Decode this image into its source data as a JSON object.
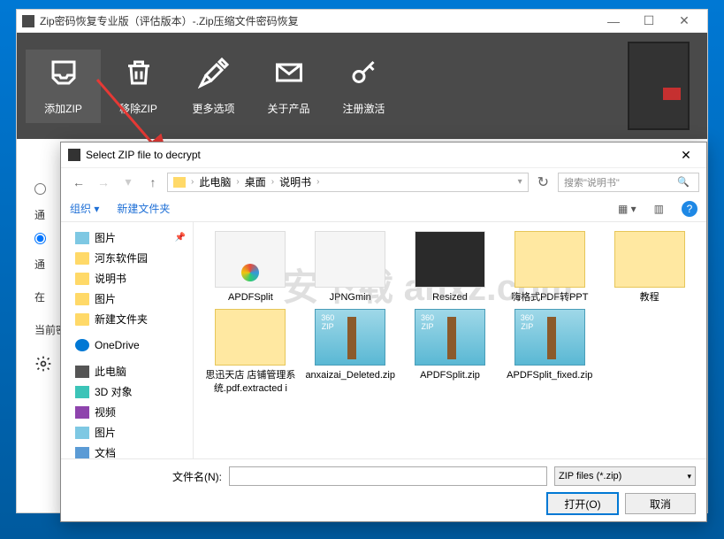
{
  "main": {
    "title": "Zip密码恢复专业版（评估版本）-.Zip压缩文件密码恢复",
    "toolbar": {
      "add_zip": "添加ZIP",
      "remove_zip": "移除ZIP",
      "more_options": "更多选项",
      "about": "关于产品",
      "register": "注册激活"
    },
    "body": {
      "radio1_label": "通",
      "radio2_label": "通",
      "side_label": "在",
      "current_label": "当前密"
    }
  },
  "dialog": {
    "title": "Select ZIP file to decrypt",
    "breadcrumb": [
      "此电脑",
      "桌面",
      "说明书"
    ],
    "search_placeholder": "搜索\"说明书\"",
    "organize": "组织",
    "new_folder": "新建文件夹",
    "tree": [
      {
        "icon": "img",
        "label": "图片",
        "pin": true
      },
      {
        "icon": "folder",
        "label": "河东软件园"
      },
      {
        "icon": "folder",
        "label": "说明书"
      },
      {
        "icon": "folder",
        "label": "图片"
      },
      {
        "icon": "folder",
        "label": "新建文件夹"
      },
      {
        "icon": "onedrive",
        "label": "OneDrive"
      },
      {
        "icon": "pc",
        "label": "此电脑"
      },
      {
        "icon": "cube",
        "label": "3D 对象"
      },
      {
        "icon": "video",
        "label": "视频"
      },
      {
        "icon": "img",
        "label": "图片"
      },
      {
        "icon": "doc",
        "label": "文档"
      }
    ],
    "files": [
      {
        "thumb": "colorful",
        "label": "APDFSplit"
      },
      {
        "thumb": "img",
        "label": "JPNGmin"
      },
      {
        "thumb": "dark",
        "label": "Resized"
      },
      {
        "thumb": "folder-open",
        "label": "嗨格式PDF转PPT"
      },
      {
        "thumb": "folder-open",
        "label": "教程"
      },
      {
        "thumb": "folder-open",
        "label": "思迅天店 店铺管理系统.pdf.extracted i"
      },
      {
        "thumb": "zip",
        "label": "anxaizai_Deleted.zip"
      },
      {
        "thumb": "zip",
        "label": "APDFSplit.zip"
      },
      {
        "thumb": "zip",
        "label": "APDFSplit_fixed.zip"
      }
    ],
    "filename_label": "文件名(N):",
    "filename_value": "",
    "filter": "ZIP files (*.zip)",
    "open_btn": "打开(O)",
    "cancel_btn": "取消"
  },
  "watermark": "安下载 anxz.com"
}
